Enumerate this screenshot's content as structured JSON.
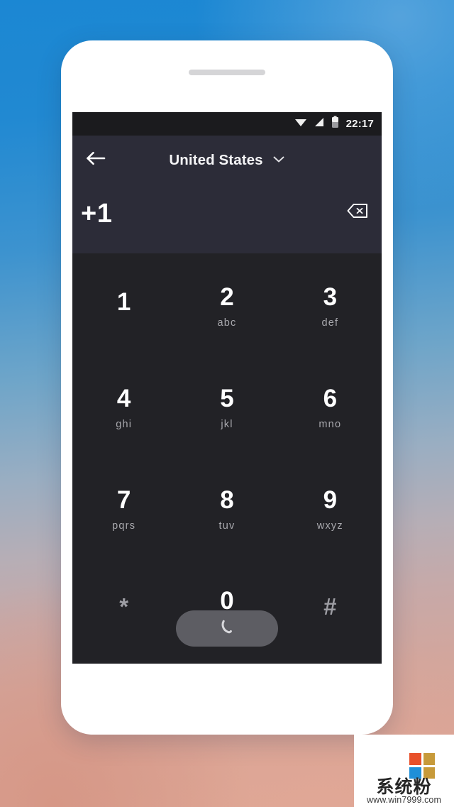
{
  "background": {
    "gradient_top": "#1b87d3",
    "gradient_mid": "#9aaec2",
    "gradient_bottom": "#dba593"
  },
  "device": {
    "frame_color": "#ffffff",
    "speaker_name": "speaker-grille"
  },
  "statusbar": {
    "time": "22:17",
    "icons": [
      "wifi-icon",
      "signal-icon",
      "battery-icon"
    ],
    "background": "#1b1b1e"
  },
  "appbar": {
    "back_icon": "back-arrow-icon",
    "title": "United States",
    "dropdown_icon": "chevron-down-icon",
    "background": "#2c2c38"
  },
  "number_field": {
    "value": "+1",
    "backspace_icon": "backspace-icon",
    "background": "#2c2c38"
  },
  "keypad": {
    "background": "#222226",
    "rows": [
      [
        {
          "digit": "1",
          "letters": ""
        },
        {
          "digit": "2",
          "letters": "abc"
        },
        {
          "digit": "3",
          "letters": "def"
        }
      ],
      [
        {
          "digit": "4",
          "letters": "ghi"
        },
        {
          "digit": "5",
          "letters": "jkl"
        },
        {
          "digit": "6",
          "letters": "mno"
        }
      ],
      [
        {
          "digit": "7",
          "letters": "pqrs"
        },
        {
          "digit": "8",
          "letters": "tuv"
        },
        {
          "digit": "9",
          "letters": "wxyz"
        }
      ],
      [
        {
          "digit": "*",
          "letters": ""
        },
        {
          "digit": "0",
          "letters": "+"
        },
        {
          "digit": "#",
          "letters": ""
        }
      ]
    ]
  },
  "call_button": {
    "icon": "phone-handset-icon",
    "label": "",
    "background": "#5d5d63"
  },
  "watermark": {
    "title": "系统粉",
    "url": "www.win7999.com",
    "logo_colors": [
      "#e8502a",
      "#c79a3a",
      "#1f8fd8",
      "#c79a3a"
    ]
  }
}
